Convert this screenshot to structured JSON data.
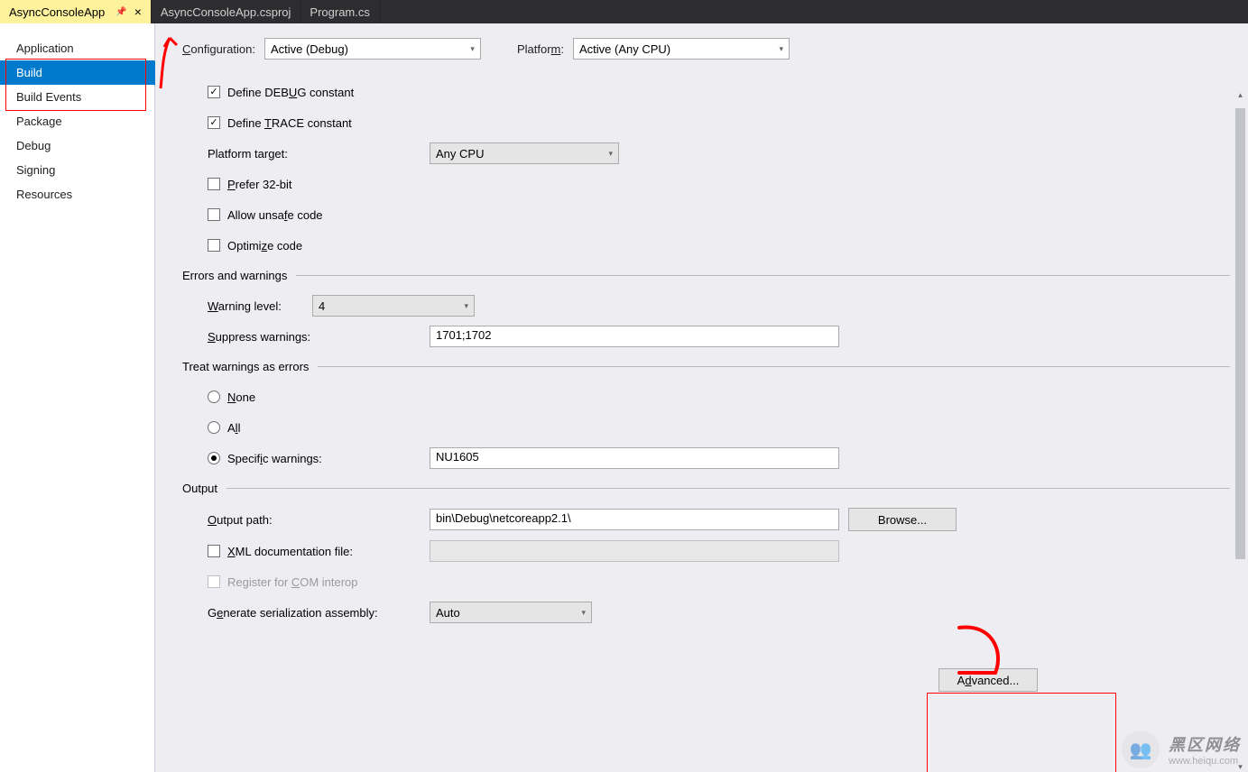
{
  "tabs": [
    {
      "label": "AsyncConsoleApp",
      "active": true,
      "pinned": true
    },
    {
      "label": "AsyncConsoleApp.csproj",
      "active": false
    },
    {
      "label": "Program.cs",
      "active": false
    }
  ],
  "sidebar": {
    "items": [
      "Application",
      "Build",
      "Build Events",
      "Package",
      "Debug",
      "Signing",
      "Resources"
    ],
    "selected_index": 1
  },
  "top": {
    "config_label": "Configuration:",
    "config_value": "Active (Debug)",
    "platform_label": "Platform:",
    "platform_value": "Active (Any CPU)"
  },
  "build": {
    "define_debug": "Define DEBUG constant",
    "define_trace": "Define TRACE constant",
    "platform_target_label": "Platform target:",
    "platform_target_value": "Any CPU",
    "prefer32": "Prefer 32-bit",
    "unsafe": "Allow unsafe code",
    "optimize": "Optimize code"
  },
  "errwarn": {
    "title": "Errors and warnings",
    "warning_level_label": "Warning level:",
    "warning_level_value": "4",
    "suppress_label": "Suppress warnings:",
    "suppress_value": "1701;1702"
  },
  "treat": {
    "title": "Treat warnings as errors",
    "none": "None",
    "all": "All",
    "specific": "Specific warnings:",
    "specific_value": "NU1605"
  },
  "output": {
    "title": "Output",
    "path_label": "Output path:",
    "path_value": "bin\\Debug\\netcoreapp2.1\\",
    "browse": "Browse...",
    "xml_doc": "XML documentation file:",
    "com": "Register for COM interop",
    "gen_label": "Generate serialization assembly:",
    "gen_value": "Auto",
    "advanced": "Advanced..."
  },
  "watermark": {
    "cn": "黑区网络",
    "url": "www.heiqu.com"
  }
}
